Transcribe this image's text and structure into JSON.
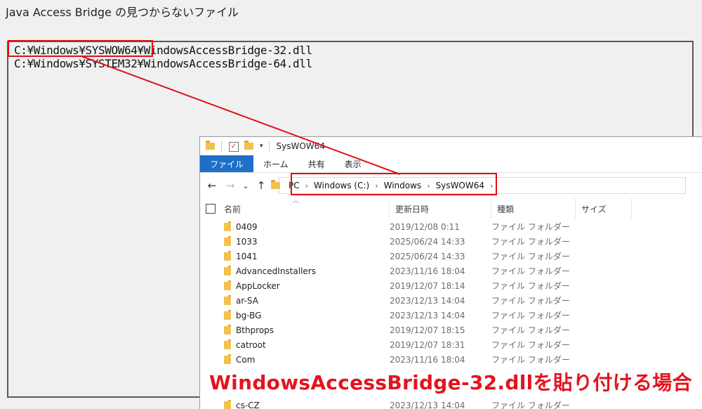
{
  "dialog": {
    "title": "Java Access Bridge の見つからないファイル",
    "paths": [
      "C:¥Windows¥SYSWOW64¥WindowsAccessBridge-32.dll",
      "C:¥Windows¥SYSTEM32¥WindowsAccessBridge-64.dll"
    ]
  },
  "explorer": {
    "window_title": "SysWOW64",
    "ribbon_tabs": [
      "ファイル",
      "ホーム",
      "共有",
      "表示"
    ],
    "address": [
      "PC",
      "Windows (C:)",
      "Windows",
      "SysWOW64"
    ],
    "columns": [
      "名前",
      "更新日時",
      "種類",
      "サイズ"
    ],
    "files": [
      {
        "name": "0409",
        "date": "2019/12/08 0:11",
        "type": "ファイル フォルダー"
      },
      {
        "name": "1033",
        "date": "2025/06/24 14:33",
        "type": "ファイル フォルダー"
      },
      {
        "name": "1041",
        "date": "2025/06/24 14:33",
        "type": "ファイル フォルダー"
      },
      {
        "name": "AdvancedInstallers",
        "date": "2023/11/16 18:04",
        "type": "ファイル フォルダー"
      },
      {
        "name": "AppLocker",
        "date": "2019/12/07 18:14",
        "type": "ファイル フォルダー"
      },
      {
        "name": "ar-SA",
        "date": "2023/12/13 14:04",
        "type": "ファイル フォルダー"
      },
      {
        "name": "bg-BG",
        "date": "2023/12/13 14:04",
        "type": "ファイル フォルダー"
      },
      {
        "name": "Bthprops",
        "date": "2019/12/07 18:15",
        "type": "ファイル フォルダー"
      },
      {
        "name": "catroot",
        "date": "2019/12/07 18:31",
        "type": "ファイル フォルダー"
      },
      {
        "name": "Com",
        "date": "2023/11/16 18:04",
        "type": "ファイル フォルダー"
      }
    ],
    "last_file": {
      "name": "cs-CZ",
      "date": "2023/12/13 14:04",
      "type": "ファイル フォルダー"
    }
  },
  "annotation": {
    "text": "WindowsAccessBridge-32.dllを貼り付ける場合",
    "color": "#e3141f"
  }
}
